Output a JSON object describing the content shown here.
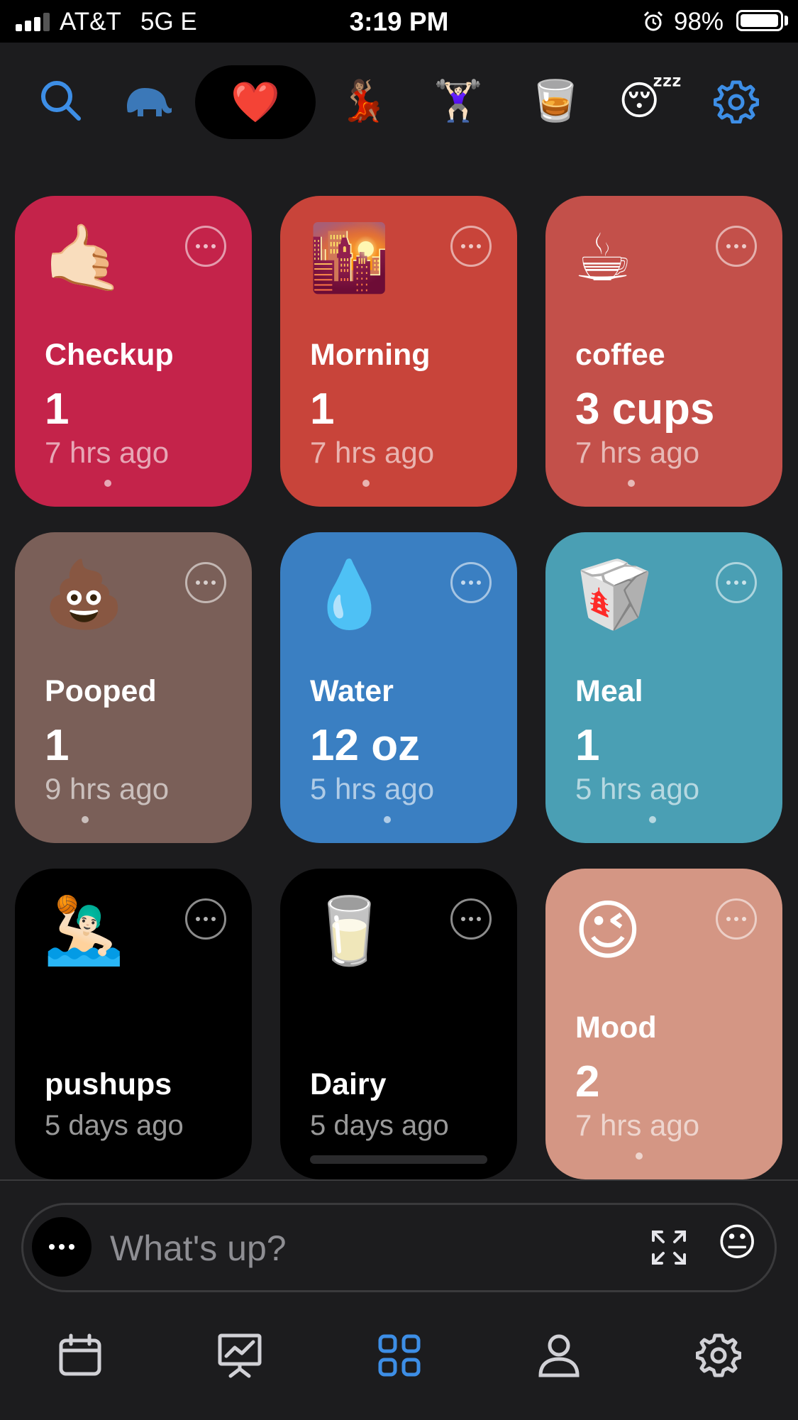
{
  "status_bar": {
    "carrier": "AT&T",
    "network": "5G E",
    "time": "3:19 PM",
    "battery_pct": "98%",
    "battery_level": 0.98,
    "signal_bars": 3
  },
  "top_bar": {
    "items": [
      {
        "name": "search",
        "icon": "search-icon"
      },
      {
        "name": "elephant",
        "glyph": "🐘"
      },
      {
        "name": "heart",
        "glyph": "❤️",
        "selected": true
      },
      {
        "name": "dancer",
        "glyph": "💃🏽"
      },
      {
        "name": "weightlifter",
        "glyph": "🏋🏻‍♀️"
      },
      {
        "name": "whiskey",
        "glyph": "🥃"
      },
      {
        "name": "sleepy",
        "glyph": "😴"
      },
      {
        "name": "settings",
        "icon": "gear-icon"
      }
    ]
  },
  "cards": [
    {
      "id": "checkup",
      "emoji": "🤙🏻",
      "title": "Checkup",
      "value": "1",
      "time": "7 hrs ago",
      "color": "#c4234a"
    },
    {
      "id": "morning",
      "emoji": "🌇",
      "title": "Morning",
      "value": "1",
      "time": "7 hrs ago",
      "color": "#c8443a"
    },
    {
      "id": "coffee",
      "emoji": "☕",
      "title": "coffee",
      "value": "3 cups",
      "time": "7 hrs ago",
      "color": "#c3504a"
    },
    {
      "id": "pooped",
      "emoji": "💩",
      "title": "Pooped",
      "value": "1",
      "time": "9 hrs ago",
      "color": "#7a5f58"
    },
    {
      "id": "water",
      "emoji": "💧",
      "title": "Water",
      "value": "12 oz",
      "time": "5 hrs ago",
      "color": "#3a7fc2"
    },
    {
      "id": "meal",
      "emoji": "🥡",
      "title": "Meal",
      "value": "1",
      "time": "5 hrs ago",
      "color": "#4a9fb4"
    },
    {
      "id": "pushups",
      "emoji": "🤽🏻‍♂️",
      "title": "pushups",
      "value": "",
      "time": "5 days ago",
      "color": "#000000"
    },
    {
      "id": "dairy",
      "emoji": "🥛",
      "title": "Dairy",
      "value": "",
      "time": "5 days ago",
      "color": "#000000"
    },
    {
      "id": "mood",
      "emoji": "😉",
      "title": "Mood",
      "value": "2",
      "time": "7 hrs ago",
      "color": "#d49684"
    }
  ],
  "input": {
    "placeholder": "What's up?",
    "emoji": "😐"
  },
  "tab_bar": {
    "items": [
      {
        "name": "calendar",
        "icon": "calendar-icon"
      },
      {
        "name": "stats",
        "icon": "chart-icon"
      },
      {
        "name": "grid",
        "icon": "grid-icon",
        "selected": true
      },
      {
        "name": "profile",
        "icon": "person-icon"
      },
      {
        "name": "settings",
        "icon": "gear-icon"
      }
    ]
  },
  "colors": {
    "accent": "#3d8ee6",
    "background": "#1c1c1e",
    "icon_gray": "#d1d1d6"
  }
}
